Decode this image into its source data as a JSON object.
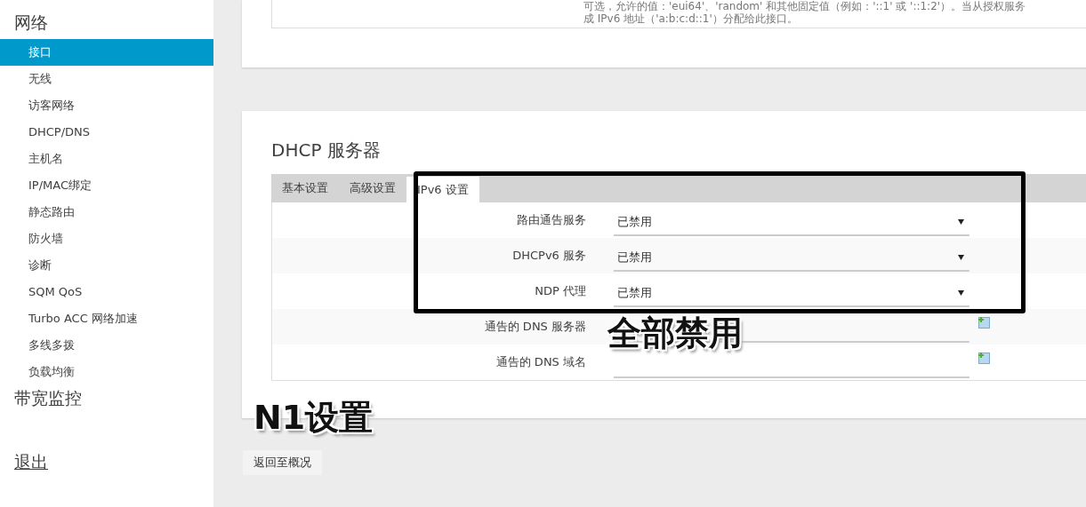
{
  "sidebar": {
    "section": "网络",
    "items": [
      {
        "label": "接口",
        "selected": true
      },
      {
        "label": "无线",
        "selected": false
      },
      {
        "label": "访客网络",
        "selected": false
      },
      {
        "label": "DHCP/DNS",
        "selected": false
      },
      {
        "label": "主机名",
        "selected": false
      },
      {
        "label": "IP/MAC绑定",
        "selected": false
      },
      {
        "label": "静态路由",
        "selected": false
      },
      {
        "label": "防火墙",
        "selected": false
      },
      {
        "label": "诊断",
        "selected": false
      },
      {
        "label": "SQM QoS",
        "selected": false
      },
      {
        "label": "Turbo ACC 网络加速",
        "selected": false
      },
      {
        "label": "多线多拨",
        "selected": false
      },
      {
        "label": "负载均衡",
        "selected": false
      }
    ],
    "section_2": "带宽监控",
    "logout": "退出"
  },
  "hint": [
    "可选，允许的值：'eui64'、'random' 和其他固定值（例如：'::1' 或 '::1:2'）。当从授权服务",
    "成 IPv6 地址（'a:b:c:d::1'）分配给此接口。"
  ],
  "dhcp": {
    "title": "DHCP 服务器",
    "tabs": [
      {
        "label": "基本设置",
        "selected": false
      },
      {
        "label": "高级设置",
        "selected": false
      },
      {
        "label": "IPv6 设置",
        "selected": true
      }
    ],
    "rows": [
      {
        "kind": "select",
        "label": "路由通告服务",
        "value": "已禁用"
      },
      {
        "kind": "select",
        "label": "DHCPv6 服务",
        "value": "已禁用"
      },
      {
        "kind": "select",
        "label": "NDP 代理",
        "value": "已禁用"
      },
      {
        "kind": "list",
        "label": "通告的 DNS 服务器"
      },
      {
        "kind": "list",
        "label": "通告的 DNS 域名"
      }
    ]
  },
  "annotations": [
    "全部禁用",
    "N1设置"
  ],
  "back_button": "返回至概况"
}
